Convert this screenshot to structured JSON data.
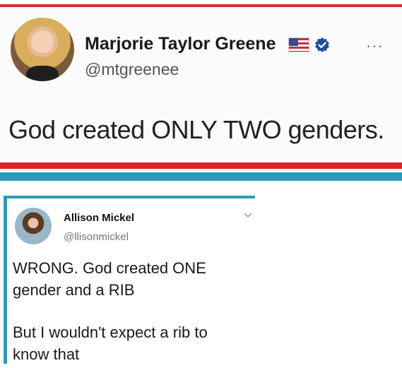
{
  "tweet": {
    "author_name": "Marjorie Taylor Greene",
    "author_handle": "@mtgreenee",
    "text": "God created ONLY TWO genders.",
    "more_label": "···"
  },
  "reply": {
    "author_name": "Allison Mickel",
    "author_handle": "@llisonmickel",
    "lines": [
      "WRONG. God created ONE",
      "gender and a RIB",
      "But I wouldn't expect a rib to",
      "know that"
    ]
  },
  "colors": {
    "stripe_red": "#d4262b",
    "stripe_blue": "#2c9bb8",
    "verified_blue": "#1d9bf0"
  }
}
